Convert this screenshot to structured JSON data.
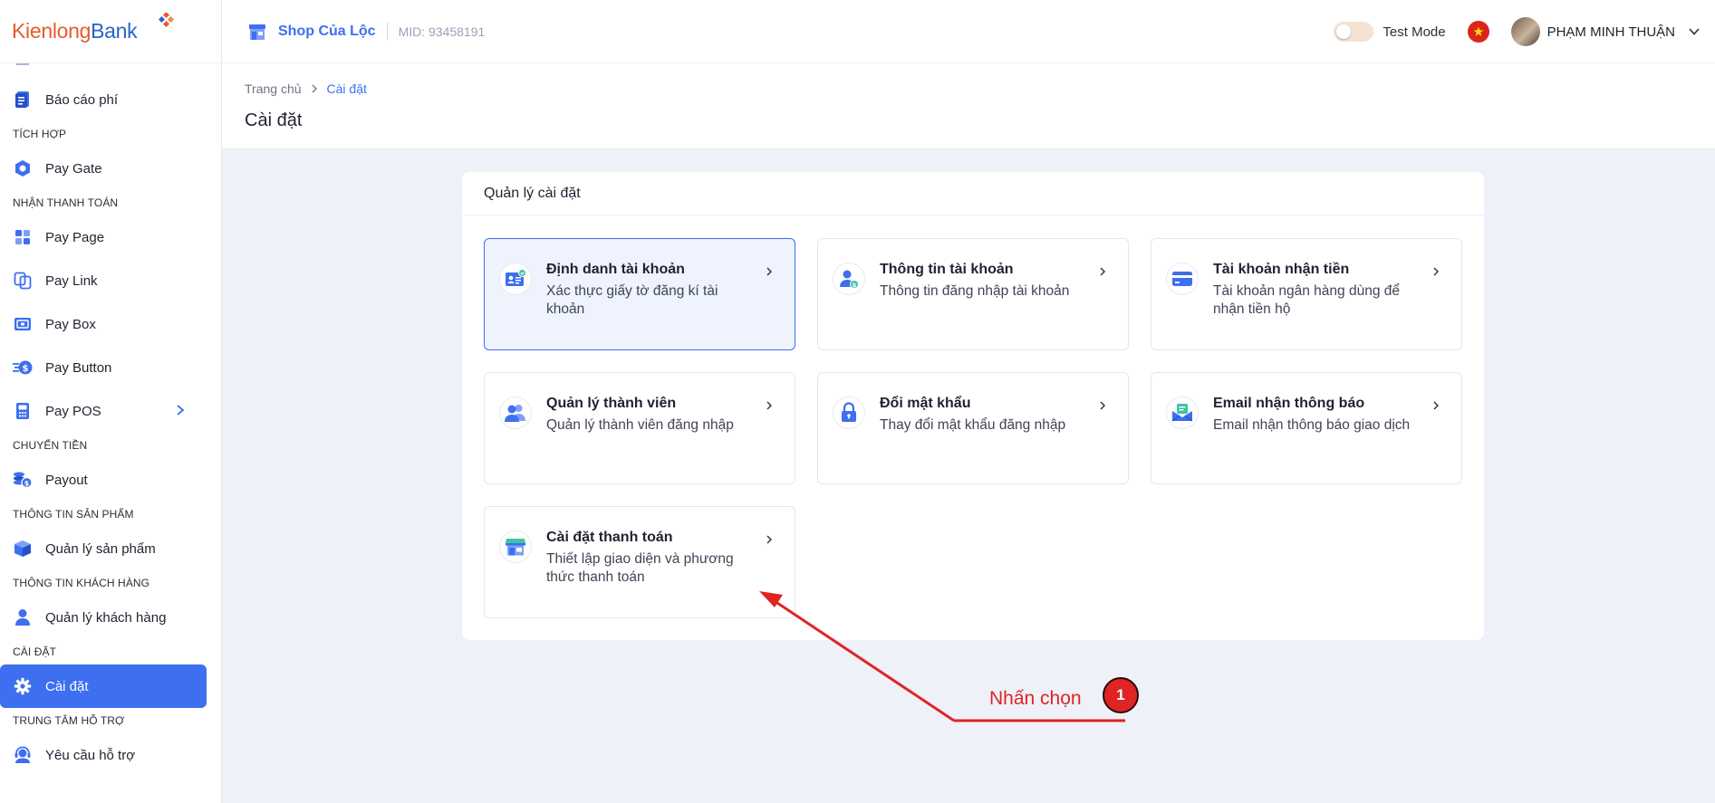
{
  "brand": {
    "part1": "Kienlong",
    "part2": "Bank"
  },
  "sidebar": {
    "items": [
      {
        "type": "item",
        "label": "Báo cáo phí",
        "icon": "document-icon"
      },
      {
        "type": "section",
        "label": "TÍCH HỢP"
      },
      {
        "type": "item",
        "label": "Pay Gate",
        "icon": "hexagon-icon"
      },
      {
        "type": "section",
        "label": "NHẬN THANH TOÁN"
      },
      {
        "type": "item",
        "label": "Pay Page",
        "icon": "grid-icon"
      },
      {
        "type": "item",
        "label": "Pay Link",
        "icon": "link-icon"
      },
      {
        "type": "item",
        "label": "Pay Box",
        "icon": "box-icon"
      },
      {
        "type": "item",
        "label": "Pay Button",
        "icon": "coin-button-icon"
      },
      {
        "type": "item",
        "label": "Pay POS",
        "icon": "pos-icon"
      },
      {
        "type": "section",
        "label": "CHUYỂN TIỀN"
      },
      {
        "type": "item",
        "label": "Payout",
        "icon": "coins-icon"
      },
      {
        "type": "section",
        "label": "THÔNG TIN SẢN PHẨM"
      },
      {
        "type": "item",
        "label": "Quản lý sản phẩm",
        "icon": "package-icon"
      },
      {
        "type": "section",
        "label": "THÔNG TIN KHÁCH HÀNG"
      },
      {
        "type": "item",
        "label": "Quản lý khách hàng",
        "icon": "user-icon"
      },
      {
        "type": "section",
        "label": "CÀI ĐẶT"
      },
      {
        "type": "item",
        "label": "Cài đặt",
        "icon": "gear-icon"
      },
      {
        "type": "section",
        "label": "TRUNG TÂM HỖ TRỢ"
      },
      {
        "type": "item",
        "label": "Yêu cầu hỗ trợ",
        "icon": "headset-icon"
      }
    ]
  },
  "header": {
    "shop_name": "Shop Của Lộc",
    "mid": "MID: 93458191",
    "test_mode_label": "Test Mode",
    "user_name": "PHẠM MINH THUẬN"
  },
  "breadcrumb": {
    "home": "Trang chủ",
    "current": "Cài đặt"
  },
  "page_title": "Cài đặt",
  "panel": {
    "title": "Quản lý cài đặt",
    "cards": [
      {
        "title": "Định danh tài khoản",
        "desc": "Xác thực giấy tờ đăng kí tài khoản",
        "icon": "id-card-icon"
      },
      {
        "title": "Thông tin tài khoản",
        "desc": "Thông tin đăng nhập tài khoản",
        "icon": "user-info-icon"
      },
      {
        "title": "Tài khoản nhận tiền",
        "desc": "Tài khoản ngân hàng dùng để nhận tiền hộ",
        "icon": "credit-card-icon"
      },
      {
        "title": "Quản lý thành viên",
        "desc": "Quản lý thành viên đăng nhập",
        "icon": "users-icon"
      },
      {
        "title": "Đổi mật khẩu",
        "desc": "Thay đổi mật khẩu đăng nhập",
        "icon": "lock-icon"
      },
      {
        "title": "Email nhận thông báo",
        "desc": "Email nhận thông báo giao dịch",
        "icon": "mail-icon"
      },
      {
        "title": "Cài đặt thanh toán",
        "desc": "Thiết lập giao diện và phương thức thanh toán",
        "icon": "store-icon"
      }
    ]
  },
  "annotation": {
    "label": "Nhấn chọn",
    "step": "1"
  },
  "colors": {
    "primary": "#3d6ff0",
    "annotation": "#e02424",
    "brand_orange": "#e85b2a"
  }
}
